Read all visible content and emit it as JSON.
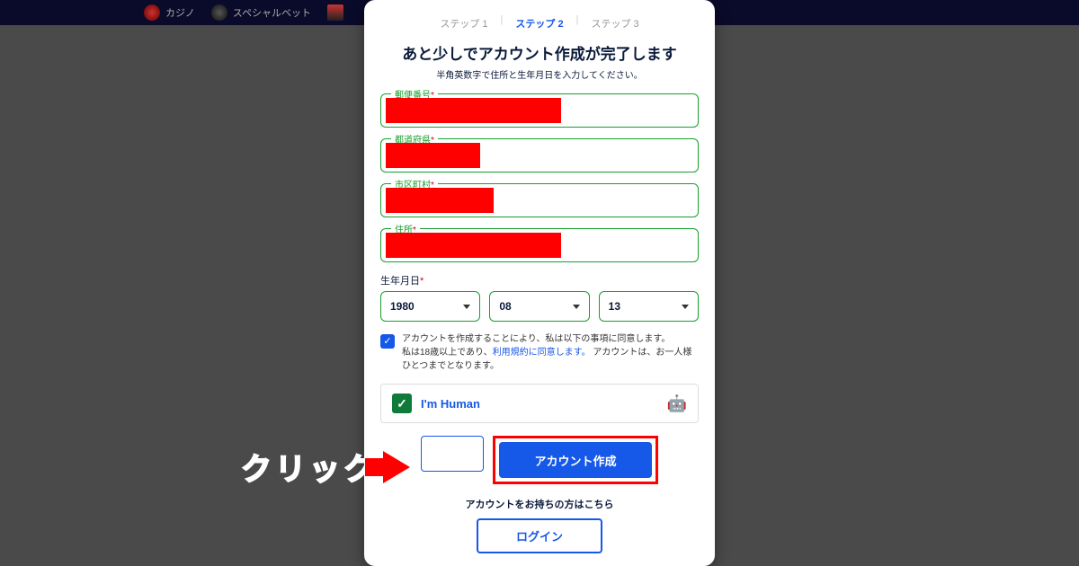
{
  "nav": {
    "items": [
      {
        "label": "カジノ"
      },
      {
        "label": "スペシャルベット"
      },
      {
        "label": ""
      }
    ]
  },
  "steps": {
    "s1": "ステップ 1",
    "s2": "ステップ 2",
    "s3": "ステップ 3"
  },
  "heading": "あと少しでアカウント作成が完了します",
  "subheading": "半角英数字で住所と生年月日を入力してください。",
  "fields": {
    "postal": {
      "label": "郵便番号",
      "req": "*"
    },
    "pref": {
      "label": "都道府県",
      "req": "*"
    },
    "city": {
      "label": "市区町村",
      "req": "*"
    },
    "addr": {
      "label": "住所",
      "req": "*"
    }
  },
  "dob": {
    "label": "生年月日",
    "req": "*",
    "year": "1980",
    "month": "08",
    "day": "13"
  },
  "consent": {
    "line1": "アカウントを作成することにより、私は以下の事項に同意します。",
    "line2a": "私は18歳以上であり、",
    "link": "利用規約に同意します。",
    "line2b": " アカウントは、お一人様ひとつまでとなります。"
  },
  "captcha": {
    "text": "I'm Human"
  },
  "buttons": {
    "create": "アカウント作成",
    "already": "アカウントをお持ちの方はこちら",
    "login": "ログイン"
  },
  "callout": "クリック"
}
